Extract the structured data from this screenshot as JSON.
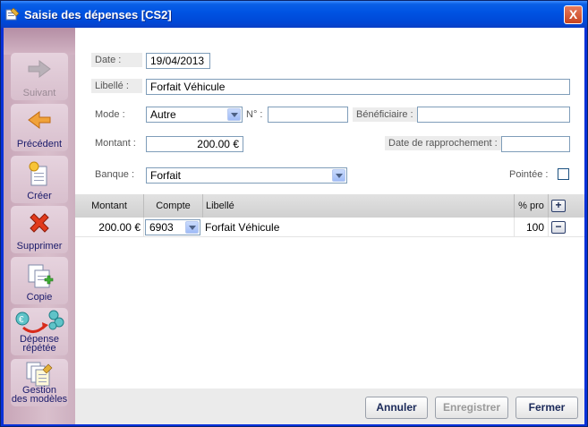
{
  "window": {
    "title": "Saisie des dépenses [CS2]",
    "close_label": "X"
  },
  "sidebar": {
    "items": [
      {
        "label": "Suivant",
        "icon": "arrow-right-icon",
        "enabled": false
      },
      {
        "label": "Précédent",
        "icon": "arrow-left-icon",
        "enabled": true
      },
      {
        "label": "Créer",
        "icon": "new-document-icon",
        "enabled": true
      },
      {
        "label": "Supprimer",
        "icon": "delete-x-icon",
        "enabled": true
      },
      {
        "label": "Copie",
        "icon": "copy-document-icon",
        "enabled": true
      },
      {
        "label_line1": "Dépense",
        "label_line2": "répétée",
        "icon": "recurring-expense-icon",
        "enabled": true
      },
      {
        "label_line1": "Gestion",
        "label_line2": "des modèles",
        "icon": "templates-icon",
        "enabled": true
      }
    ]
  },
  "form": {
    "date_label": "Date :",
    "date_value": "19/04/2013",
    "libelle_label": "Libellé :",
    "libelle_value": "Forfait Véhicule",
    "mode_label": "Mode :",
    "mode_value": "Autre",
    "numero_label": "N° :",
    "numero_value": "",
    "beneficiaire_label": "Bénéficiaire :",
    "beneficiaire_value": "",
    "montant_label": "Montant :",
    "montant_value": "200.00 €",
    "date_rapprochement_label": "Date de rapprochement :",
    "date_rapprochement_value": "",
    "banque_label": "Banque :",
    "banque_value": "Forfait",
    "pointee_label": "Pointée :",
    "pointee_checked": false
  },
  "grid": {
    "headers": {
      "montant": "Montant",
      "compte": "Compte",
      "libelle": "Libellé",
      "pct": "% pro"
    },
    "add_label": "+",
    "rows": [
      {
        "montant": "200.00 €",
        "compte": "6903",
        "libelle": "Forfait Véhicule",
        "pct": "100",
        "remove_label": "−"
      }
    ]
  },
  "footer": {
    "annuler": "Annuler",
    "enregistrer": "Enregistrer",
    "fermer": "Fermer"
  }
}
